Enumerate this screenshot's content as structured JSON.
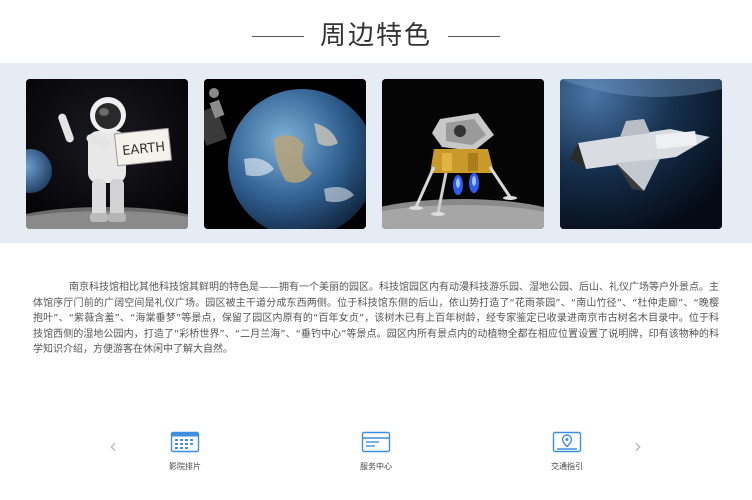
{
  "section": {
    "title": "周边特色"
  },
  "gallery": {
    "images": [
      {
        "name": "astronaut-earth-sign",
        "sign_text": "EARTH"
      },
      {
        "name": "earth-from-space"
      },
      {
        "name": "lunar-module"
      },
      {
        "name": "space-shuttle"
      }
    ]
  },
  "description": "南京科技馆相比其他科技馆其鲜明的特色是——拥有一个美丽的园区。科技馆园区内有动漫科技游乐园、湿地公园、后山、礼仪广场等户外景点。主体馆序厅门前的广阔空间是礼仪广场。园区被主干道分成东西两侧。位于科技馆东侧的后山，依山势打造了“花雨茶园”、“南山竹径”、“杜仲走廊”、“晚樱抱叶”、“紫薇含羞”、“海棠垂梦”等景点，保留了园区内原有的“百年女贞”，该树木已有上百年树龄，经专家鉴定已收录进南京市古树名木目录中。位于科技馆西侧的湿地公园内，打造了“彩桥世界”、“二月兰海”、“垂钓中心”等景点。园区内所有景点内的动植物全都在相应位置设置了说明牌，印有该物种的科学知识介绍，方便游客在休闲中了解大自然。",
  "quick_links": [
    {
      "label": "影院排片",
      "icon": "calendar-icon"
    },
    {
      "label": "服务中心",
      "icon": "service-card-icon"
    },
    {
      "label": "交通指引",
      "icon": "map-pin-icon"
    }
  ],
  "nav": {
    "prev_glyph": "‹",
    "next_glyph": "›"
  },
  "colors": {
    "icon_blue": "#3f8ee0",
    "gallery_bg": "#e5ecf4",
    "text": "#555555"
  }
}
